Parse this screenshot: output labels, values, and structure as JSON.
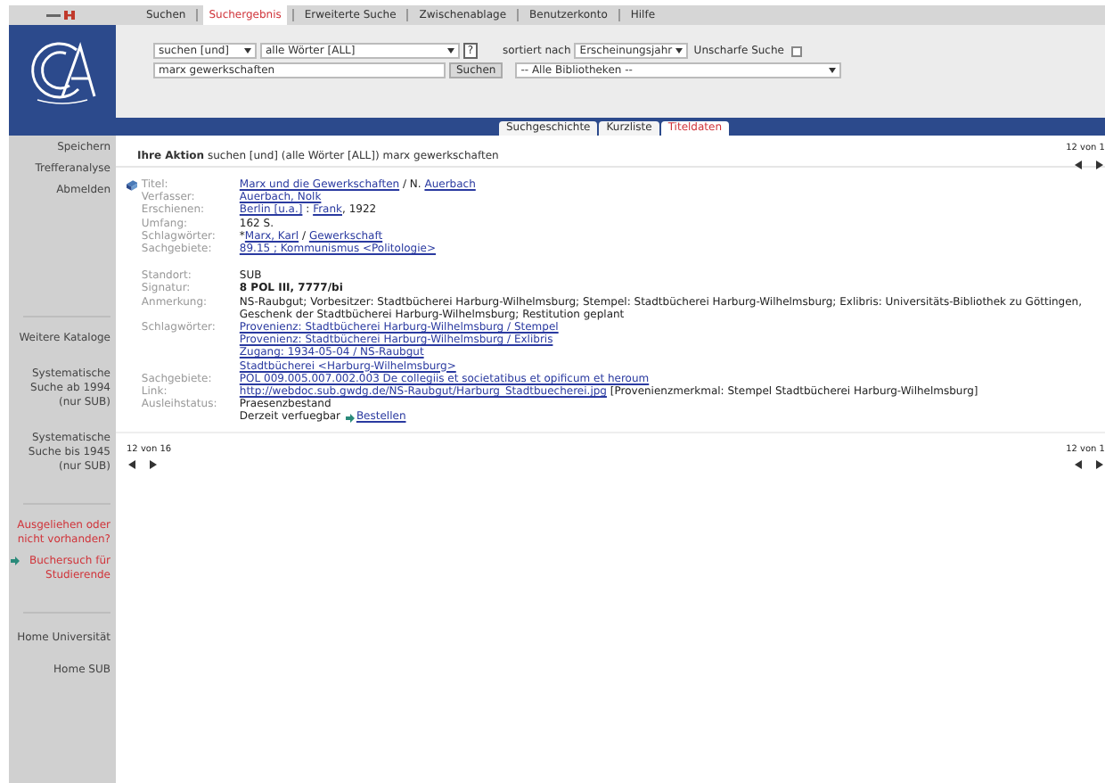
{
  "top_tabs": [
    {
      "label": "Suchen",
      "selected": false
    },
    {
      "label": "Suchergebnis",
      "selected": true
    },
    {
      "label": "Erweiterte Suche",
      "selected": false
    },
    {
      "label": "Zwischenablage",
      "selected": false
    },
    {
      "label": "Benutzerkonto",
      "selected": false
    },
    {
      "label": "Hilfe",
      "selected": false
    }
  ],
  "search": {
    "operator": "suchen [und]",
    "field": "alle Wörter [ALL]",
    "help": "?",
    "sort_label": "sortiert nach",
    "sort": "Erscheinungsjahr",
    "fuzzy_label": "Unscharfe Suche",
    "fuzzy_checked": false,
    "query": "marx gewerkschaften",
    "submit": "Suchen",
    "library": "-- Alle Bibliotheken --"
  },
  "view_tabs": [
    {
      "label": "Suchgeschichte",
      "selected": false
    },
    {
      "label": "Kurzliste",
      "selected": false
    },
    {
      "label": "Titeldaten",
      "selected": true
    }
  ],
  "sidebar": {
    "groups": [
      {
        "items": [
          {
            "label": "Speichern",
            "kind": "plain"
          },
          {
            "label": "Trefferanalyse",
            "kind": "plain"
          },
          {
            "label": "Abmelden",
            "kind": "plain"
          }
        ]
      },
      {
        "items": [
          {
            "label": "Weitere Kataloge",
            "kind": "plain"
          },
          {
            "label": "Systematische Suche ab 1994 (nur SUB)",
            "kind": "plain"
          },
          {
            "label": "Systematische Suche bis 1945 (nur SUB)",
            "kind": "plain"
          }
        ]
      },
      {
        "items": [
          {
            "label": "Ausgeliehen oder nicht vorhanden?",
            "kind": "alert"
          },
          {
            "label": "Buchersuch für Studierende",
            "kind": "alert-link"
          }
        ]
      },
      {
        "items": [
          {
            "label": "Home Universität",
            "kind": "plain"
          },
          {
            "label": "Home SUB",
            "kind": "plain"
          }
        ]
      }
    ]
  },
  "action": "**Ihre Aktion** suchen [und] (alle Wörter [ALL]) marx gewerkschaften",
  "pager_top": "12 von 1",
  "record": {
    "sections": [
      {
        "fields": [
          {
            "label": "Titel:",
            "lines": [
              [
                {
                  "kind": "link",
                  "text": "Marx und die Gewerkschaften"
                },
                {
                  "kind": "text",
                  "text": " / N. "
                },
                {
                  "kind": "link",
                  "text": "Auerbach"
                }
              ]
            ]
          },
          {
            "label": "Verfasser:",
            "lines": [
              [
                {
                  "kind": "link",
                  "text": "Auerbach, Nolk"
                }
              ]
            ]
          },
          {
            "label": "Erschienen:",
            "lines": [
              [
                {
                  "kind": "link",
                  "text": "Berlin [u.a.]"
                },
                {
                  "kind": "text",
                  "text": " : "
                },
                {
                  "kind": "link",
                  "text": "Frank"
                },
                {
                  "kind": "text",
                  "text": ", 1922"
                }
              ]
            ]
          },
          {
            "label": "Umfang:",
            "lines": [
              [
                {
                  "kind": "text",
                  "text": "162 S."
                }
              ]
            ]
          },
          {
            "label": "Schlagwörter:",
            "lines": [
              [
                {
                  "kind": "text",
                  "text": "*"
                },
                {
                  "kind": "link",
                  "text": "Marx, Karl"
                },
                {
                  "kind": "text",
                  "text": " / "
                },
                {
                  "kind": "link",
                  "text": "Gewerkschaft"
                }
              ]
            ]
          },
          {
            "label": "Sachgebiete:",
            "lines": [
              [
                {
                  "kind": "link",
                  "text": "89.15 ; Kommunismus <Politologie>"
                }
              ]
            ]
          }
        ]
      },
      {
        "fields": [
          {
            "label": "Standort:",
            "lines": [
              [
                {
                  "kind": "text",
                  "text": "SUB"
                }
              ]
            ]
          },
          {
            "label": "Signatur:",
            "lines": [
              [
                {
                  "kind": "bold",
                  "text": "8 POL III, 7777/bi"
                }
              ]
            ]
          },
          {
            "label": "Anmerkung:",
            "lines": [
              [
                {
                  "kind": "text",
                  "text": "NS-Raubgut; Vorbesitzer: Stadtbücherei Harburg-Wilhelmsburg; Stempel: Stadtbücherei Harburg-Wilhelmsburg; Exlibris: Universitäts-Bibliothek zu Göttingen, Geschenk der Stadtbücherei Harburg-Wilhelmsburg; Restitution geplant"
                }
              ]
            ]
          },
          {
            "label": "Schlagwörter:",
            "lines": [
              [
                {
                  "kind": "link",
                  "text": "Provenienz: Stadtbücherei Harburg-Wilhelmsburg / Stempel"
                }
              ],
              [
                {
                  "kind": "link",
                  "text": "Provenienz: Stadtbücherei Harburg-Wilhelmsburg / Exlibris"
                }
              ],
              [
                {
                  "kind": "link",
                  "text": "Zugang: 1934-05-04 / NS-Raubgut"
                }
              ],
              [
                {
                  "kind": "link",
                  "text": "Stadtbücherei <Harburg-Wilhelmsburg>"
                }
              ]
            ]
          },
          {
            "label": "Sachgebiete:",
            "lines": [
              [
                {
                  "kind": "link",
                  "text": "POL 009.005.007.002.003 De collegiis et societatibus et opificum et heroum"
                }
              ]
            ]
          },
          {
            "label": "Link:",
            "lines": [
              [
                {
                  "kind": "link",
                  "text": "http://webdoc.sub.gwdg.de/NS-Raubgut/Harburg_Stadtbuecherei.jpg"
                },
                {
                  "kind": "text",
                  "text": " [Provenienzmerkmal: Stempel Stadtbücherei Harburg-Wilhelmsburg]"
                }
              ]
            ]
          },
          {
            "label": "Ausleihstatus:",
            "lines": [
              [
                {
                  "kind": "text",
                  "text": "Praesenzbestand"
                }
              ],
              [
                {
                  "kind": "text",
                  "text": "Derzeit verfuegbar "
                },
                {
                  "kind": "order",
                  "text": "Bestellen"
                }
              ]
            ]
          }
        ]
      }
    ]
  },
  "pager_bottom_left": "12 von 16",
  "pager_bottom_right": "12 von 1"
}
